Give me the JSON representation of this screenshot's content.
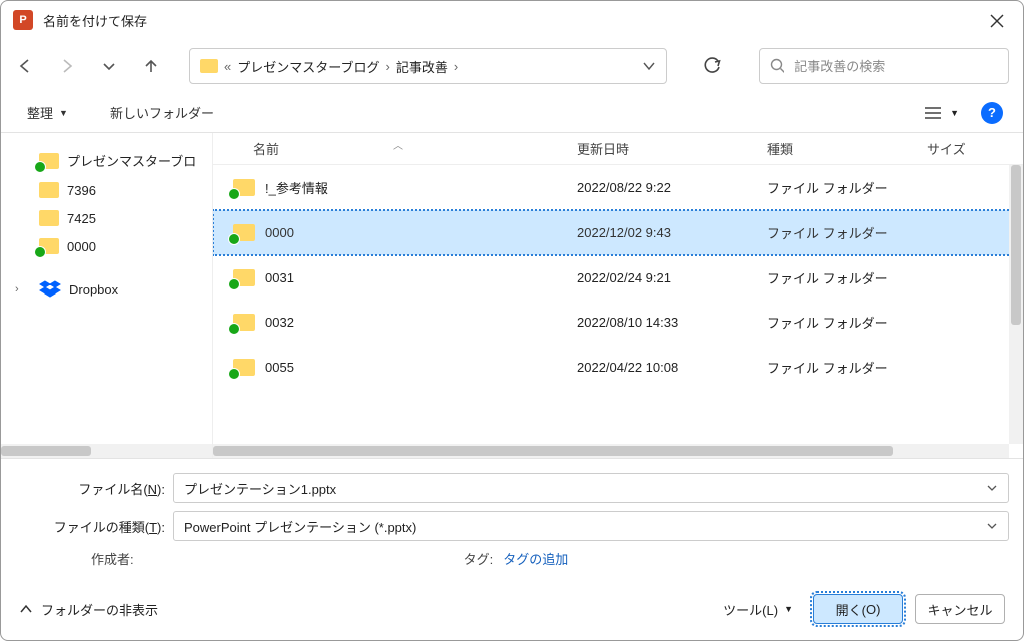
{
  "title": "名前を付けて保存",
  "breadcrumb": {
    "overflow": "«",
    "seg1": "プレゼンマスターブログ",
    "seg2": "記事改善"
  },
  "search": {
    "placeholder": "記事改善の検索"
  },
  "toolbar": {
    "organize": "整理",
    "newFolder": "新しいフォルダー"
  },
  "treeItems": [
    {
      "label": "プレゼンマスターブロ",
      "sync": true
    },
    {
      "label": "7396",
      "sync": false
    },
    {
      "label": "7425",
      "sync": false
    },
    {
      "label": "0000",
      "sync": true
    },
    {
      "label": "Dropbox",
      "dropbox": true
    }
  ],
  "headers": {
    "name": "名前",
    "date": "更新日時",
    "type": "種類",
    "size": "サイズ"
  },
  "rows": [
    {
      "name": "!_参考情報",
      "date": "2022/08/22 9:22",
      "type": "ファイル フォルダー"
    },
    {
      "name": "0000",
      "date": "2022/12/02 9:43",
      "type": "ファイル フォルダー",
      "selected": true
    },
    {
      "name": "0031",
      "date": "2022/02/24 9:21",
      "type": "ファイル フォルダー"
    },
    {
      "name": "0032",
      "date": "2022/08/10 14:33",
      "type": "ファイル フォルダー"
    },
    {
      "name": "0055",
      "date": "2022/04/22 10:08",
      "type": "ファイル フォルダー"
    }
  ],
  "filename": {
    "label_pre": "ファイル名(",
    "label_u": "N",
    "label_post": "):",
    "value": "プレゼンテーション1.pptx"
  },
  "filetype": {
    "label_pre": "ファイルの種類(",
    "label_u": "T",
    "label_post": "):",
    "value": "PowerPoint プレゼンテーション (*.pptx)"
  },
  "author": {
    "label": "作成者:"
  },
  "tag": {
    "label": "タグ:",
    "link": "タグの追加"
  },
  "footer": {
    "hideFolders": "フォルダーの非表示",
    "tools_pre": "ツール(",
    "tools_u": "L",
    "tools_post": ")",
    "open_pre": "開く(",
    "open_u": "O",
    "open_post": ")",
    "cancel": "キャンセル"
  }
}
